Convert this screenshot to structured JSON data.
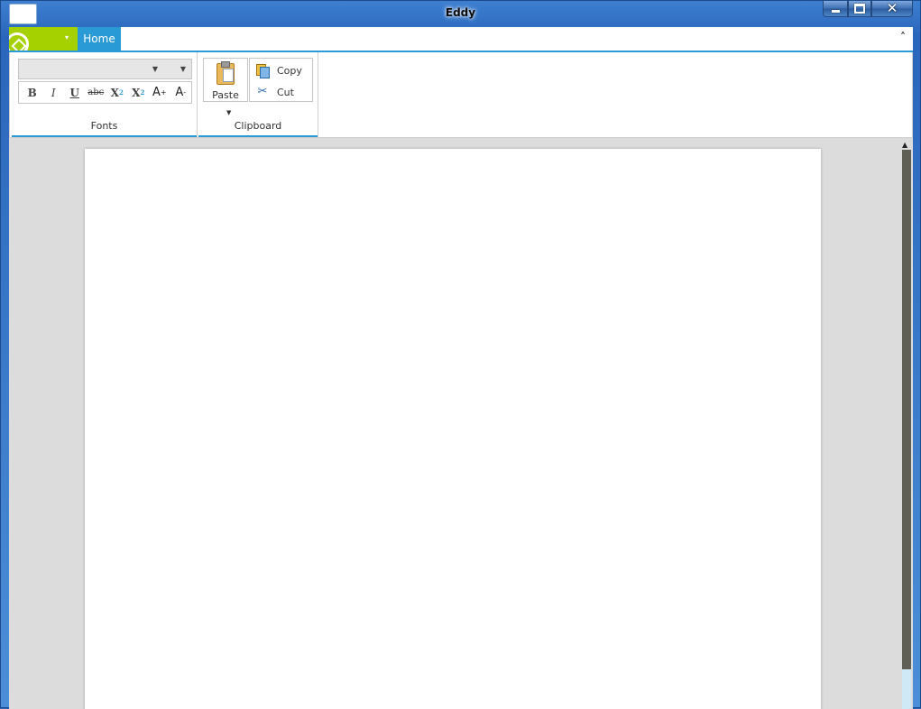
{
  "window": {
    "title": "Eddy",
    "controls": {
      "minimize": "minimize-icon",
      "maximize": "maximize-icon",
      "close": "✕"
    }
  },
  "ribbon": {
    "app_menu_arrow": "▾",
    "tabs": [
      {
        "label": "Home",
        "selected": true
      }
    ],
    "collapse_glyph": "˄",
    "groups": {
      "fonts": {
        "label": "Fonts",
        "font_family_value": "",
        "font_size_value": "",
        "buttons": {
          "bold": "B",
          "italic": "I",
          "underline": "U",
          "strikethrough": "abc",
          "subscript_base": "X",
          "subscript_mark": "2",
          "superscript_base": "X",
          "superscript_mark": "2",
          "grow_base": "A",
          "grow_mark": "+",
          "shrink_base": "A",
          "shrink_mark": "-"
        }
      },
      "clipboard": {
        "label": "Clipboard",
        "paste_label": "Paste",
        "copy_label": "Copy",
        "cut_label": "Cut"
      }
    }
  },
  "colors": {
    "accent": "#2a9ad7",
    "app_menu": "#a5d100",
    "workspace": "#dcdcdc"
  }
}
